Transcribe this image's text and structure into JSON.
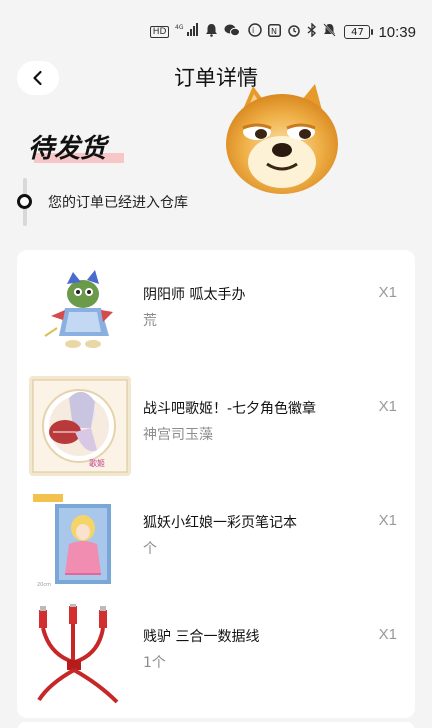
{
  "status_bar": {
    "icons": [
      "HD",
      "4G",
      "signal",
      "bell",
      "wechat",
      "notification",
      "nfc",
      "alarm",
      "bluetooth",
      "mute",
      "vibrate"
    ],
    "battery": "47",
    "time": "10:39"
  },
  "header": {
    "title": "订单详情",
    "back_icon": "chevron-left-icon"
  },
  "order_status": {
    "heading": "待发货",
    "message": "您的订单已经进入仓库"
  },
  "products": [
    {
      "name": "阴阳师 呱太手办",
      "spec": "荒",
      "qty": "X1"
    },
    {
      "name": "战斗吧歌姬！-七夕角色徽章",
      "spec": "神宫司玉藻",
      "qty": "X1"
    },
    {
      "name": "狐妖小红娘一彩页笔记本",
      "spec": "个",
      "qty": "X1"
    },
    {
      "name": " 贱驴 三合一数据线",
      "spec": "1个",
      "qty": "X1"
    }
  ],
  "colors": {
    "background": "#f4f4f4",
    "card": "#ffffff",
    "muted_text": "#8c8c8c",
    "heading_highlight": "#f7c6c6"
  }
}
